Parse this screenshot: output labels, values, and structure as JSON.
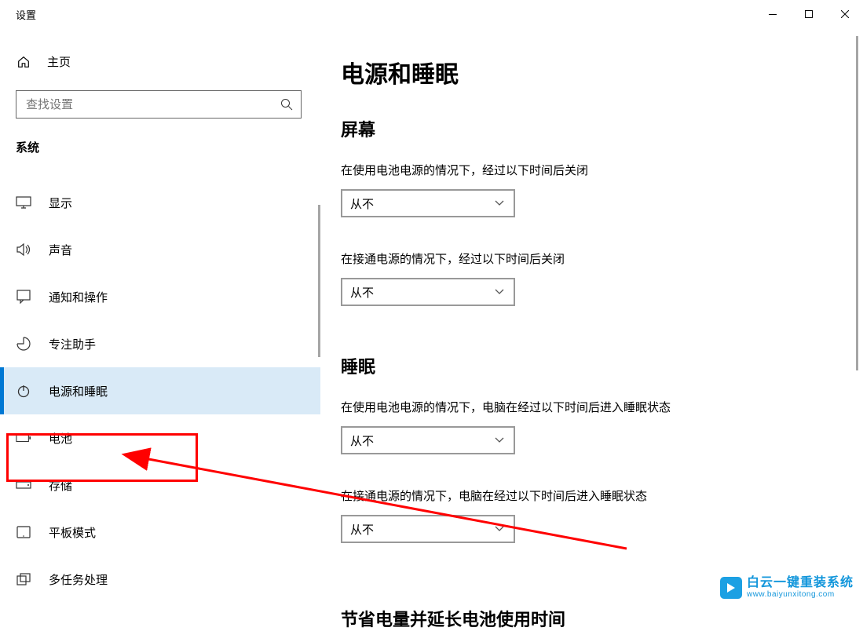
{
  "window": {
    "title": "设置"
  },
  "sidebar": {
    "home": "主页",
    "search_placeholder": "查找设置",
    "category": "系统",
    "items": [
      {
        "label": "显示",
        "icon": "display-icon"
      },
      {
        "label": "声音",
        "icon": "sound-icon"
      },
      {
        "label": "通知和操作",
        "icon": "notifications-icon"
      },
      {
        "label": "专注助手",
        "icon": "focus-assist-icon"
      },
      {
        "label": "电源和睡眠",
        "icon": "power-icon"
      },
      {
        "label": "电池",
        "icon": "battery-icon"
      },
      {
        "label": "存储",
        "icon": "storage-icon"
      },
      {
        "label": "平板模式",
        "icon": "tablet-icon"
      },
      {
        "label": "多任务处理",
        "icon": "multitask-icon"
      }
    ]
  },
  "main": {
    "title": "电源和睡眠",
    "section_screen": {
      "title": "屏幕",
      "battery_label": "在使用电池电源的情况下，经过以下时间后关闭",
      "battery_value": "从不",
      "plugged_label": "在接通电源的情况下，经过以下时间后关闭",
      "plugged_value": "从不"
    },
    "section_sleep": {
      "title": "睡眠",
      "battery_label": "在使用电池电源的情况下，电脑在经过以下时间后进入睡眠状态",
      "battery_value": "从不",
      "plugged_label": "在接通电源的情况下，电脑在经过以下时间后进入睡眠状态",
      "plugged_value": "从不"
    },
    "section_save": {
      "title": "节省电量并延长电池使用时间"
    }
  },
  "watermark": {
    "title": "白云一键重装系统",
    "url": "www.baiyunxitong.com"
  }
}
